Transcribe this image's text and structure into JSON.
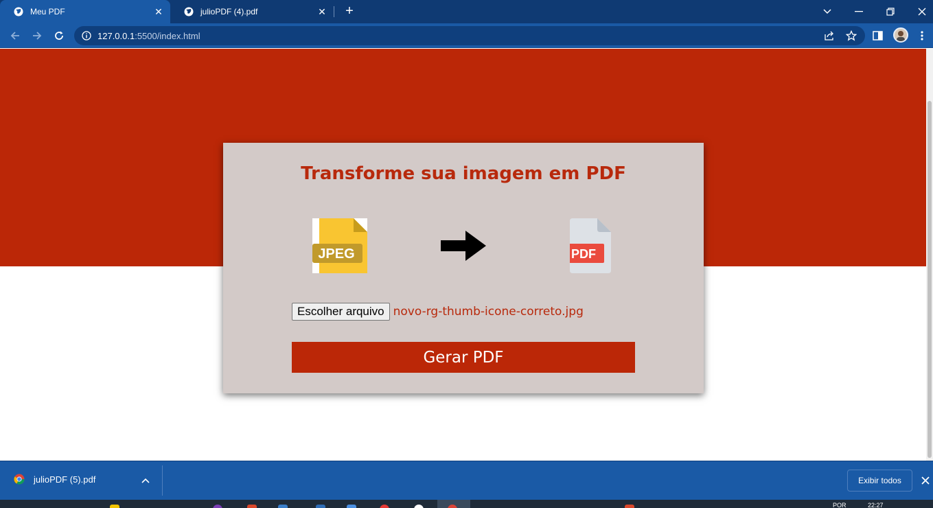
{
  "browser": {
    "tabs": [
      {
        "title": "Meu PDF",
        "active": true
      },
      {
        "title": "julioPDF (4).pdf",
        "active": false
      }
    ],
    "url_host": "127.0.0.1",
    "url_rest": ":5500/index.html"
  },
  "page": {
    "title": "Transforme sua imagem em PDF",
    "jpeg_label": "JPEG",
    "pdf_label": "PDF",
    "file_button": "Escolher arquivo",
    "file_name": "novo-rg-thumb-icone-correto.jpg",
    "generate_button": "Gerar PDF",
    "colors": {
      "primary": "#bb2707",
      "card": "#d3cac8"
    }
  },
  "downloads": {
    "file": "julioPDF (5).pdf",
    "show_all": "Exibir todos"
  },
  "taskbar": {
    "lang": "POR",
    "time": "22:27"
  }
}
